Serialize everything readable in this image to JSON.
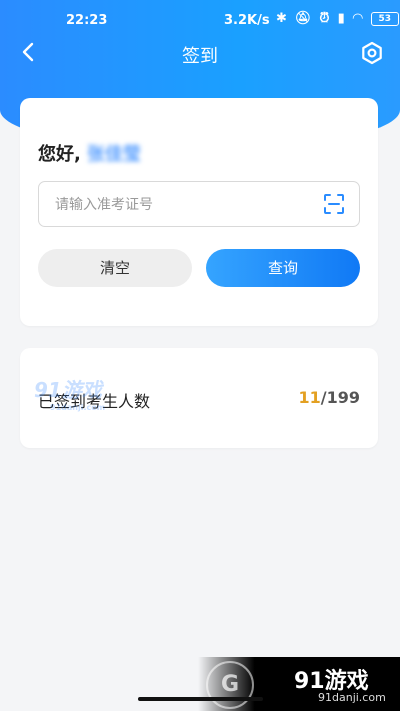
{
  "status_bar": {
    "time": "22:23",
    "net_speed": "3.2K/s",
    "battery": "53"
  },
  "nav": {
    "title": "签到"
  },
  "signin_card": {
    "greeting": "您好,",
    "user_name": "张佳莹",
    "input_placeholder": "请输入准考证号",
    "input_value": "",
    "clear_label": "清空",
    "query_label": "查询"
  },
  "stats_card": {
    "label": "已签到考生人数",
    "signed_count": "11",
    "separator": "/",
    "total_count": "199"
  },
  "watermark": {
    "logo_text": "91游戏",
    "site": "91danji.com"
  },
  "colors": {
    "brand_blue": "#1a8dff",
    "count_highlight": "#e3a022"
  }
}
